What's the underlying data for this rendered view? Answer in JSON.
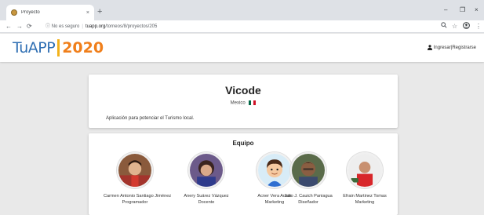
{
  "browser": {
    "tab_title": "Proyecto",
    "tab_close": "×",
    "new_tab": "+",
    "security_label": "No es seguro",
    "url_host": "tuapp.org",
    "url_path": "/torneos/8/proyectos/205",
    "window_minimize": "–",
    "window_restore": "❐",
    "window_close": "×"
  },
  "site": {
    "logo_part1": "TuAPP",
    "logo_part2": "2020",
    "auth_label": "Ingresar|Registrarse",
    "colors": {
      "logo_blue": "#2f6fb3",
      "logo_orange": "#f07f1b",
      "logo_bar": "#f2b21b"
    }
  },
  "project": {
    "name": "Vicode",
    "country": "Mexico",
    "description": "Aplicación para potenciar el Turismo local."
  },
  "team": {
    "title": "Equipo",
    "members": [
      {
        "name": "Carmen Antonio Santiago Jiménez",
        "role": "Programador"
      },
      {
        "name": "Anery Suárez Vázquez",
        "role": "Docente"
      },
      {
        "name": "Acner Vera Arcos",
        "role": "Marketing"
      },
      {
        "name": "Julio J. Cauich Paniagua",
        "role": "Diseñador"
      },
      {
        "name": "Efrain Martinez Tomas",
        "role": "Marketing"
      }
    ]
  }
}
